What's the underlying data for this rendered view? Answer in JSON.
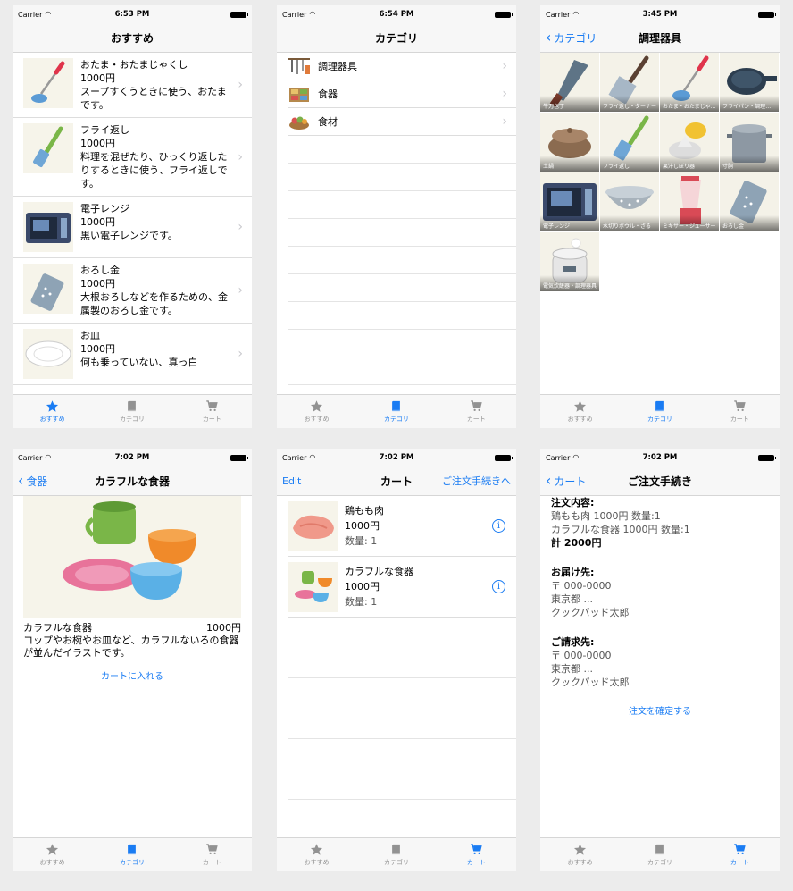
{
  "status_bars": [
    {
      "carrier": "Carrier",
      "time": "6:53 PM"
    },
    {
      "carrier": "Carrier",
      "time": "6:54 PM"
    },
    {
      "carrier": "Carrier",
      "time": "3:45 PM"
    },
    {
      "carrier": "Carrier",
      "time": "7:02 PM"
    },
    {
      "carrier": "Carrier",
      "time": "7:02 PM"
    },
    {
      "carrier": "Carrier",
      "time": "7:02 PM"
    }
  ],
  "tabs": {
    "recommend": "おすすめ",
    "category": "カテゴリ",
    "cart": "カート"
  },
  "accent_color": "#1a7cf3",
  "screen1": {
    "title": "おすすめ",
    "items": [
      {
        "name": "おたま・おたまじゃくし",
        "price": "1000円",
        "desc": "スープすくうときに使う、おたまです。",
        "icon": "ladle-icon"
      },
      {
        "name": "フライ返し",
        "price": "1000円",
        "desc": "料理を混ぜたり、ひっくり返したりするときに使う、フライ返しです。",
        "icon": "spatula-icon"
      },
      {
        "name": "電子レンジ",
        "price": "1000円",
        "desc": "黒い電子レンジです。",
        "icon": "microwave-icon"
      },
      {
        "name": "おろし金",
        "price": "1000円",
        "desc": "大根おろしなどを作るための、金属製のおろし金です。",
        "icon": "grater-icon"
      },
      {
        "name": "お皿",
        "price": "1000円",
        "desc": "何も乗っていない、真っ白",
        "icon": "plate-icon"
      }
    ]
  },
  "screen2": {
    "title": "カテゴリ",
    "items": [
      {
        "label": "調理器具",
        "icon": "utensils-icon"
      },
      {
        "label": "食器",
        "icon": "dishes-icon"
      },
      {
        "label": "食材",
        "icon": "vegetables-icon"
      }
    ]
  },
  "screen3": {
    "back": "カテゴリ",
    "title": "調理器具",
    "cells": [
      {
        "caption": "牛刀包丁",
        "icon": "knife-icon"
      },
      {
        "caption": "フライ返し・ターナー",
        "icon": "turner-icon"
      },
      {
        "caption": "おたま・おたまじゃくし",
        "icon": "ladle-icon"
      },
      {
        "caption": "フライパン・調理器具",
        "icon": "frying-pan-icon"
      },
      {
        "caption": "土鍋",
        "icon": "clay-pot-icon"
      },
      {
        "caption": "フライ返し",
        "icon": "spatula-icon"
      },
      {
        "caption": "果汁しぼり器",
        "icon": "juicer-icon"
      },
      {
        "caption": "寸胴",
        "icon": "stockpot-icon"
      },
      {
        "caption": "電子レンジ",
        "icon": "microwave-icon"
      },
      {
        "caption": "水切りボウル・ざる",
        "icon": "colander-icon"
      },
      {
        "caption": "ミキサー・ジューサー",
        "icon": "blender-icon"
      },
      {
        "caption": "おろし金",
        "icon": "grater-icon"
      },
      {
        "caption": "電気炊飯器・調理器具",
        "icon": "rice-cooker-icon"
      }
    ]
  },
  "screen4": {
    "back": "食器",
    "title": "カラフルな食器",
    "name": "カラフルな食器",
    "price": "1000円",
    "desc": "コップやお椀やお皿など、カラフルないろの食器が並んだイラストです。",
    "add_to_cart": "カートに入れる"
  },
  "screen5": {
    "edit": "Edit",
    "title": "カート",
    "checkout": "ご注文手続きへ",
    "items": [
      {
        "name": "鶏もも肉",
        "price": "1000円",
        "qty": "数量: 1",
        "icon": "chicken-icon"
      },
      {
        "name": "カラフルな食器",
        "price": "1000円",
        "qty": "数量: 1",
        "icon": "dishes-icon"
      }
    ]
  },
  "screen6": {
    "back": "カート",
    "title": "ご注文手続き",
    "order_head": "注文内容:",
    "order_lines": [
      "鶏もも肉 1000円 数量:1",
      "カラフルな食器 1000円 数量:1"
    ],
    "total": "計 2000円",
    "ship_head": "お届け先:",
    "ship_lines": [
      "〒 000-0000",
      "東京都 ...",
      "クックパッド太郎"
    ],
    "bill_head": "ご請求先:",
    "bill_lines": [
      "〒 000-0000",
      "東京都 ...",
      "クックパッド太郎"
    ],
    "confirm": "注文を確定する"
  }
}
